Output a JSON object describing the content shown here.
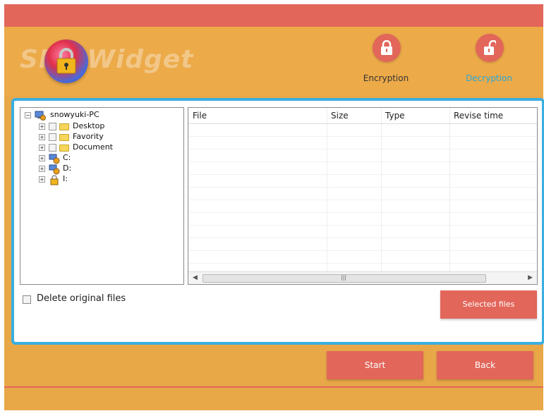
{
  "app": {
    "logo_text": "SPP Widget"
  },
  "modes": {
    "encryption_label": "Encryption",
    "decryption_label": "Decryption"
  },
  "tree": {
    "root": "snowyuki-PC",
    "folders": [
      "Desktop",
      "Favority",
      "Document"
    ],
    "drives": [
      "C:",
      "D:",
      "I:"
    ]
  },
  "filelist": {
    "columns": [
      "File",
      "Size",
      "Type",
      "Revise time"
    ],
    "rows": []
  },
  "options": {
    "delete_original_label": "Delete original files",
    "delete_original_checked": false
  },
  "buttons": {
    "selected_files": "Selected files",
    "start": "Start",
    "back": "Back"
  },
  "colors": {
    "accent": "#e2665a",
    "background": "#e8a848",
    "panel_border": "#3aaee0",
    "decryption_active": "#2aa8d8"
  },
  "icons": {
    "logo": "padlock-icon",
    "encryption": "locked-padlock-icon",
    "decryption": "unlocked-padlock-icon",
    "computer": "computer-icon",
    "folder": "folder-icon",
    "drive": "drive-icon",
    "locked_drive": "locked-drive-icon"
  }
}
